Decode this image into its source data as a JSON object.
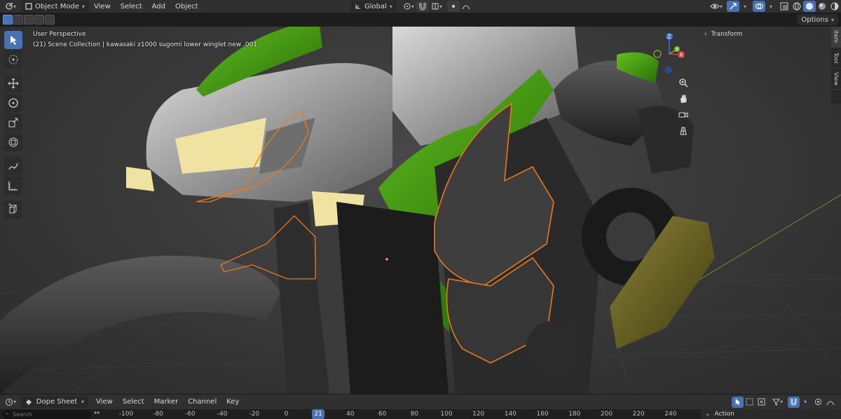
{
  "header": {
    "mode_label": "Object Mode",
    "menus": [
      "View",
      "Select",
      "Add",
      "Object"
    ],
    "orientation_label": "Global"
  },
  "toolbar_options": {
    "options_label": "Options"
  },
  "viewport": {
    "view_name": "User Perspective",
    "collection_info": "(21) Scene Collection | kawasaki z1000 sugomi lower winglet new .001",
    "gizmo_axes": {
      "z": "Z",
      "y": "Y",
      "x": "X"
    },
    "background_color": "#3a3a3a"
  },
  "sidebar": {
    "transform_label": "Transform",
    "tabs": [
      "Item",
      "Tool",
      "View"
    ]
  },
  "timeline": {
    "editor_label": "Dope Sheet",
    "menus": [
      "View",
      "Select",
      "Marker",
      "Channel",
      "Key"
    ],
    "search_placeholder": "Search",
    "ticks": [
      "-100",
      "-80",
      "-60",
      "-40",
      "-20",
      "0",
      "21",
      "40",
      "60",
      "80",
      "100",
      "120",
      "140",
      "160",
      "180",
      "200",
      "220",
      "240"
    ],
    "current_frame": "21",
    "action_label": "Action"
  },
  "colors": {
    "accent": "#4772b3",
    "bike_green": "#3a8f12",
    "selection_outline": "#e87a1c",
    "headlight": "#f0e2a0",
    "exhaust": "#6e6624"
  }
}
